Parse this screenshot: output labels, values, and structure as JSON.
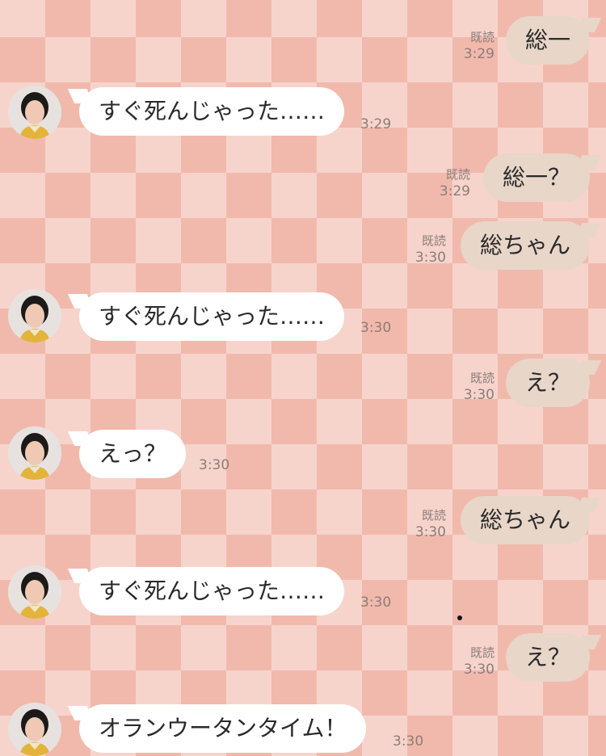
{
  "messages": [
    {
      "side": "out",
      "text": "総一",
      "read": "既読",
      "time": "3:29"
    },
    {
      "side": "in",
      "text": "すぐ死んじゃった……",
      "time": "3:29"
    },
    {
      "side": "out",
      "text": "総一？",
      "read": "既読",
      "time": "3:29"
    },
    {
      "side": "out",
      "text": "総ちゃん",
      "read": "既読",
      "time": "3:30"
    },
    {
      "side": "in",
      "text": "すぐ死んじゃった……",
      "time": "3:30"
    },
    {
      "side": "out",
      "text": "え？",
      "read": "既読",
      "time": "3:30"
    },
    {
      "side": "in",
      "text": "えっ？",
      "time": "3:30"
    },
    {
      "side": "out",
      "text": "総ちゃん",
      "read": "既読",
      "time": "3:30"
    },
    {
      "side": "in",
      "text": "すぐ死んじゃった……",
      "time": "3:30"
    },
    {
      "side": "out",
      "text": "え？",
      "read": "既読",
      "time": "3:30"
    },
    {
      "side": "in",
      "text": "オランウータンタイム！",
      "time": "3:30"
    }
  ],
  "colors": {
    "incoming_bubble": "#ffffff",
    "outgoing_bubble": "#e8d6c9",
    "meta_text": "#8c7d78",
    "check_dark": "#f1b9ac",
    "check_light": "#f6d4cc"
  },
  "icons": {
    "avatar": "contact-avatar-photo"
  }
}
